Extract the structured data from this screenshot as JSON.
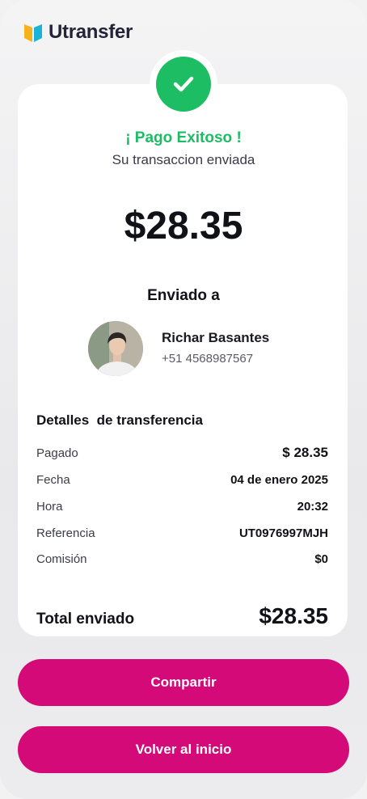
{
  "app": {
    "brand_name": "Utransfer",
    "accent_color": "#d30a78",
    "success_color": "#1dbd64"
  },
  "status": {
    "icon": "check-icon",
    "title": "¡ Pago Exitoso !",
    "subtitle": "Su transaccion enviada"
  },
  "amount": "$28.35",
  "recipient": {
    "heading": "Enviado a",
    "name": "Richar Basantes",
    "phone": "+51 4568987567"
  },
  "details": {
    "title": "Detalles  de transferencia",
    "rows": [
      {
        "label": "Pagado",
        "value": "$ 28.35"
      },
      {
        "label": "Fecha",
        "value": "04 de enero 2025"
      },
      {
        "label": "Hora",
        "value": "20:32"
      },
      {
        "label": "Referencia",
        "value": "UT0976997MJH"
      },
      {
        "label": "Comisión",
        "value": "$0"
      }
    ],
    "total_label": "Total enviado",
    "total_value": "$28.35"
  },
  "actions": {
    "share_label": "Compartir",
    "home_label": "Volver al inicio"
  }
}
